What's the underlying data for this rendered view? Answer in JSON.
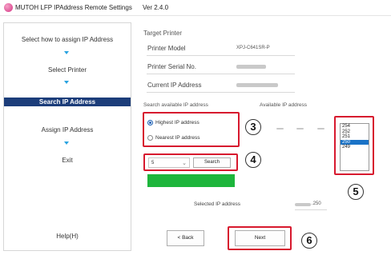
{
  "titlebar": {
    "title": "MUTOH LFP IPAddress Remote Settings",
    "version": "Ver 2.4.0"
  },
  "sidebar": {
    "steps": [
      {
        "label": "Select how to assign IP Address"
      },
      {
        "label": "Select Printer"
      },
      {
        "label": "Search IP Address"
      },
      {
        "label": "Assign IP Address"
      },
      {
        "label": "Exit"
      }
    ],
    "help": "Help(H)"
  },
  "target": {
    "heading": "Target Printer",
    "model_label": "Printer Model",
    "model_value": "XPJ-C641SR-P",
    "serial_label": "Printer Serial No.",
    "ip_label": "Current IP Address"
  },
  "search": {
    "heading": "Search available IP address",
    "options": [
      {
        "label": "Highest IP address",
        "checked": true
      },
      {
        "label": "Nearest IP address",
        "checked": false
      }
    ],
    "count_value": "5",
    "search_button": "Search",
    "progress_percent": 100
  },
  "available": {
    "heading": "Available IP address",
    "ips": [
      "254",
      "252",
      "251",
      "250",
      "249"
    ],
    "selected_index": 3
  },
  "selected": {
    "label": "Selected IP address",
    "value_suffix": ".250"
  },
  "buttons": {
    "back": "< Back",
    "next": "Next"
  },
  "callouts": {
    "c3": "3",
    "c4": "4",
    "c5": "5",
    "c6": "6"
  },
  "colors": {
    "active_step": "#1c3d7a",
    "arrow": "#29a3e0",
    "highlight": "#d7192e",
    "progress": "#1db53c",
    "selection": "#1a73c7"
  }
}
